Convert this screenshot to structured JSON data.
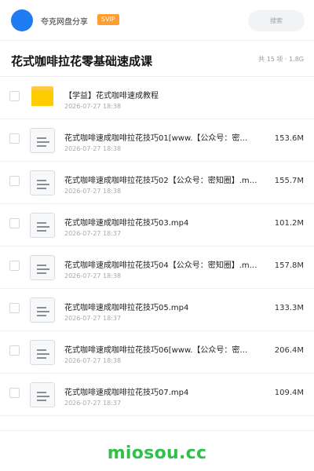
{
  "header": {
    "share_name": "夸克网盘分享",
    "badge": "SVIP",
    "search_label": "搜索"
  },
  "title_bar": {
    "title": "花式咖啡拉花零基础速成课",
    "summary": "共 15 项 · 1.8G"
  },
  "files": [
    {
      "type": "folder",
      "name": "【学益】花式咖啡速成教程",
      "date": "2026-07-27 18:38",
      "size": ""
    },
    {
      "type": "file",
      "name": "花式咖啡速成咖啡拉花技巧01[www.【公众号：密…",
      "date": "2026-07-27 18:38",
      "size": "153.6M"
    },
    {
      "type": "file",
      "name": "花式咖啡速成咖啡拉花技巧02【公众号：密知圈】.m…",
      "date": "2026-07-27 18:38",
      "size": "155.7M"
    },
    {
      "type": "file",
      "name": "花式咖啡速成咖啡拉花技巧03.mp4",
      "date": "2026-07-27 18:37",
      "size": "101.2M"
    },
    {
      "type": "file",
      "name": "花式咖啡速成咖啡拉花技巧04【公众号：密知圈】.m…",
      "date": "2026-07-27 18:38",
      "size": "157.8M"
    },
    {
      "type": "file",
      "name": "花式咖啡速成咖啡拉花技巧05.mp4",
      "date": "2026-07-27 18:37",
      "size": "133.3M"
    },
    {
      "type": "file",
      "name": "花式咖啡速成咖啡拉花技巧06[www.【公众号：密…",
      "date": "2026-07-27 18:38",
      "size": "206.4M"
    },
    {
      "type": "file",
      "name": "花式咖啡速成咖啡拉花技巧07.mp4",
      "date": "2026-07-27 18:37",
      "size": "109.4M"
    }
  ],
  "footer": {
    "watermark": "miosou.cc",
    "watermark_color": "#2fc24a"
  },
  "colors": {
    "accent": "#1e7bf2",
    "badge": "#ff9d2e",
    "folder": "#ffcc00"
  },
  "icons": {
    "folder": "folder-icon",
    "file": "file-icon"
  }
}
